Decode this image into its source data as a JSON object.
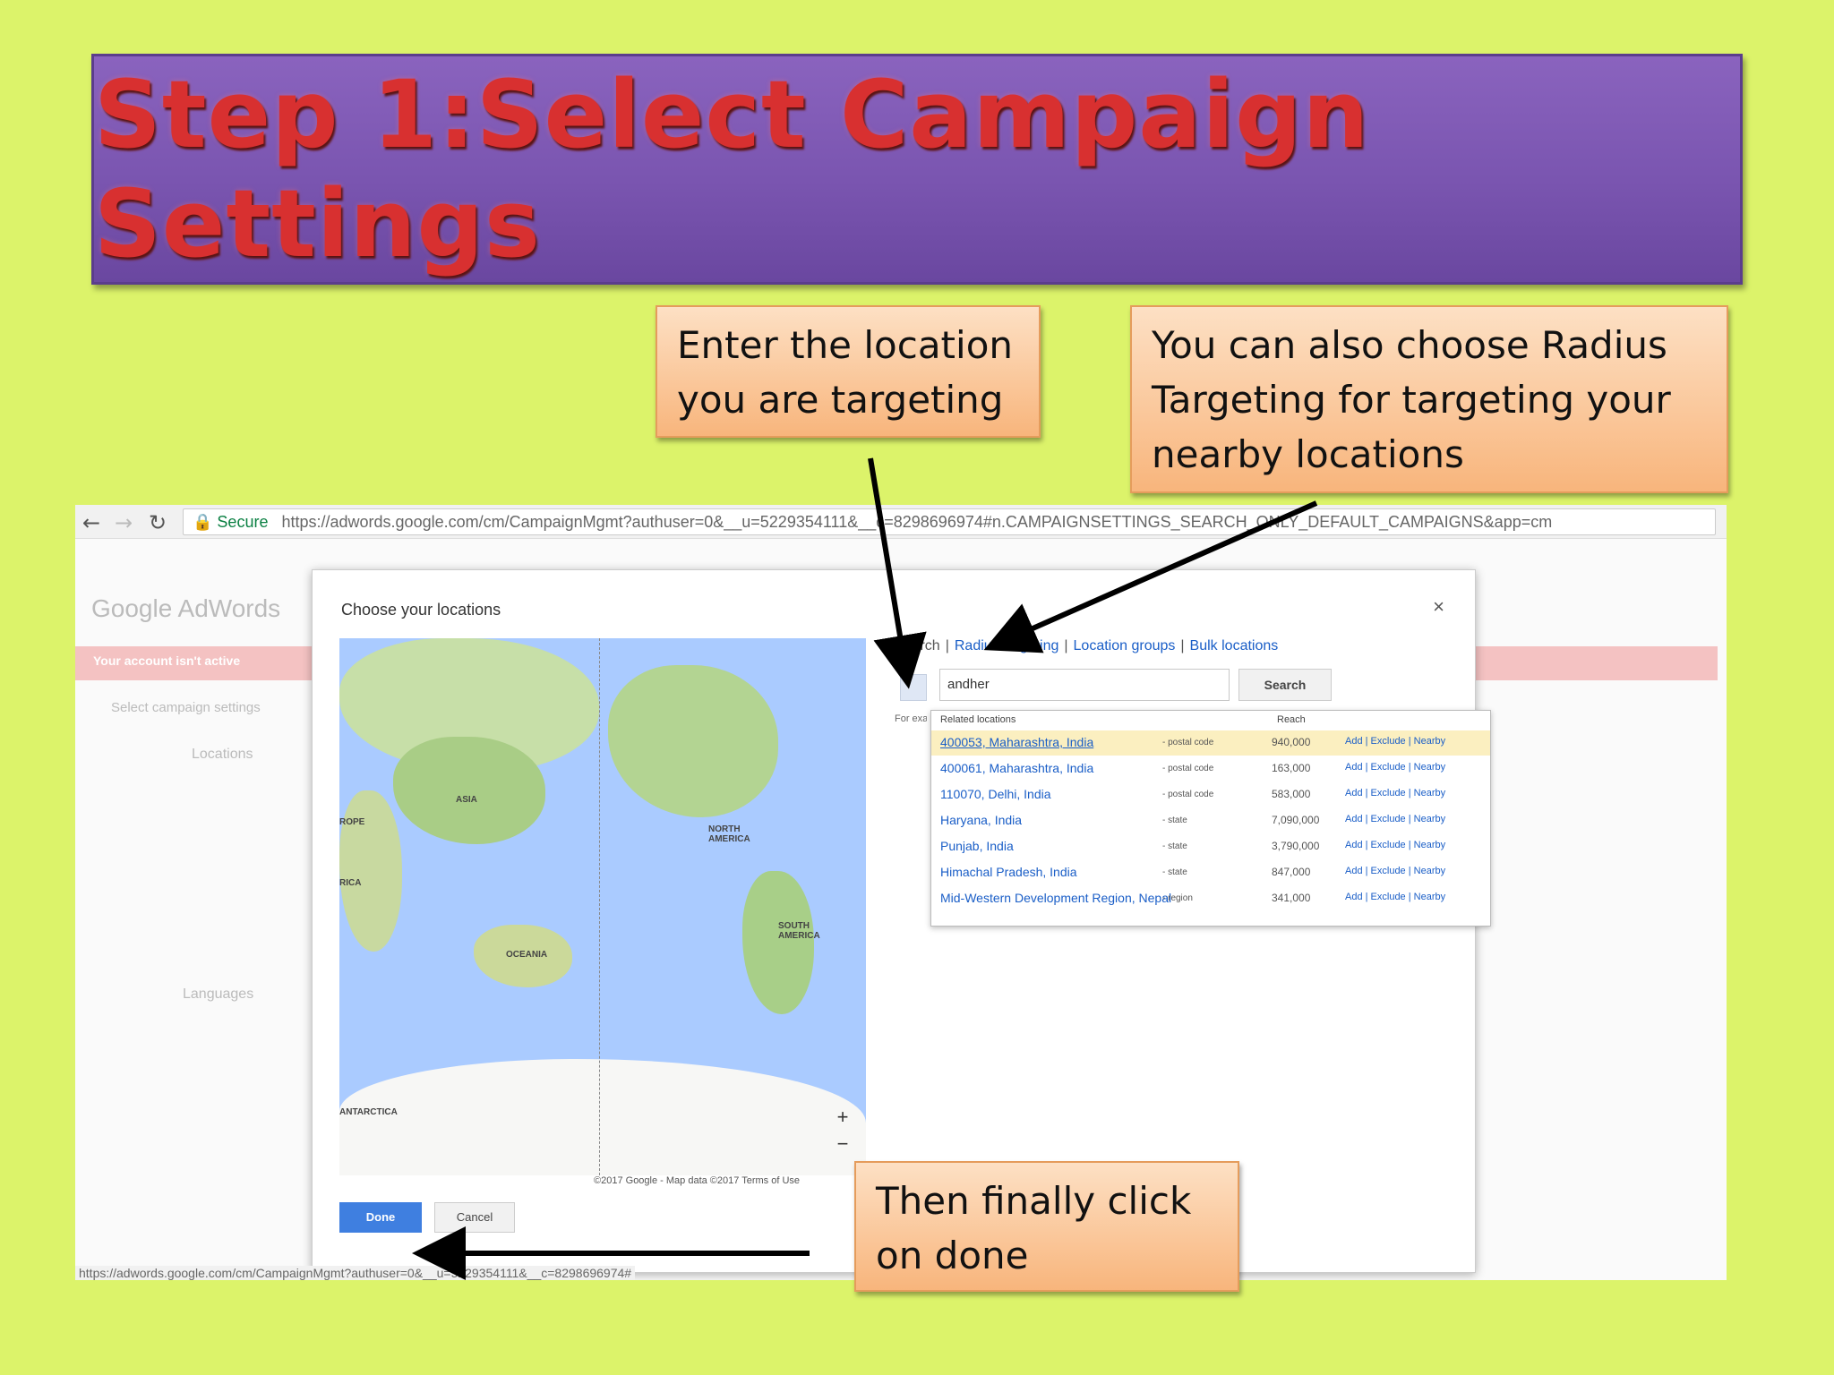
{
  "slide": {
    "title": "Step 1:Select Campaign Settings",
    "callout_location": "Enter the location you are targeting",
    "callout_radius": "You can also choose Radius Targeting for targeting your nearby locations",
    "callout_done": "Then finally click on done"
  },
  "browser": {
    "secure_label": "Secure",
    "url": "https://adwords.google.com/cm/CampaignMgmt?authuser=0&__u=5229354111&__c=8298696974#n.CAMPAIGNSETTINGS_SEARCH_ONLY_DEFAULT_CAMPAIGNS&app=cm",
    "status_url": "https://adwords.google.com/cm/CampaignMgmt?authuser=0&__u=5229354111&__c=8298696974#"
  },
  "app": {
    "logo": "Google AdWords",
    "alert": "Your account isn't active",
    "step": "Select campaign settings",
    "locations_label": "Locations",
    "languages_label": "Languages"
  },
  "modal": {
    "title": "Choose your locations",
    "close": "×",
    "tabs": {
      "search": "Search",
      "radius": "Radius targeting",
      "groups": "Location groups",
      "bulk": "Bulk locations"
    },
    "search_value": "andher",
    "search_button": "Search",
    "for_example": "For example, a country, city, region or postal code",
    "results_header": "Related locations",
    "reach_header": "Reach",
    "results": [
      {
        "name": "400053, Maharashtra, India",
        "type": "- postal code",
        "reach": "940,000",
        "highlighted": true
      },
      {
        "name": "400061, Maharashtra, India",
        "type": "- postal code",
        "reach": "163,000",
        "highlighted": false
      },
      {
        "name": "110070, Delhi, India",
        "type": "- postal code",
        "reach": "583,000",
        "highlighted": false
      },
      {
        "name": "Haryana, India",
        "type": "- state",
        "reach": "7,090,000",
        "highlighted": false
      },
      {
        "name": "Punjab, India",
        "type": "- state",
        "reach": "3,790,000",
        "highlighted": false
      },
      {
        "name": "Himachal Pradesh, India",
        "type": "- state",
        "reach": "847,000",
        "highlighted": false
      },
      {
        "name": "Mid-Western Development Region, Nepal",
        "type": "- region",
        "reach": "341,000",
        "highlighted": false
      }
    ],
    "action_labels": "Add | Exclude | Nearby",
    "map_labels": {
      "asia": "ASIA",
      "europe": "ROPE",
      "africa": "RICA",
      "oceania": "OCEANIA",
      "north_america": "NORTH AMERICA",
      "south_america": "SOUTH AMERICA",
      "antarctica": "ANTARCTICA"
    },
    "map_attribution": "©2017 Google - Map data ©2017   Terms of Use",
    "zoom_in": "+",
    "zoom_out": "−",
    "done_button": "Done",
    "cancel_button": "Cancel"
  },
  "colors": {
    "background": "#dcf36a",
    "banner": "#7a55b0",
    "title_text": "#d83030",
    "callout": "#f8b57c",
    "link": "#1a5ec7",
    "done_button": "#3f7fe0"
  }
}
